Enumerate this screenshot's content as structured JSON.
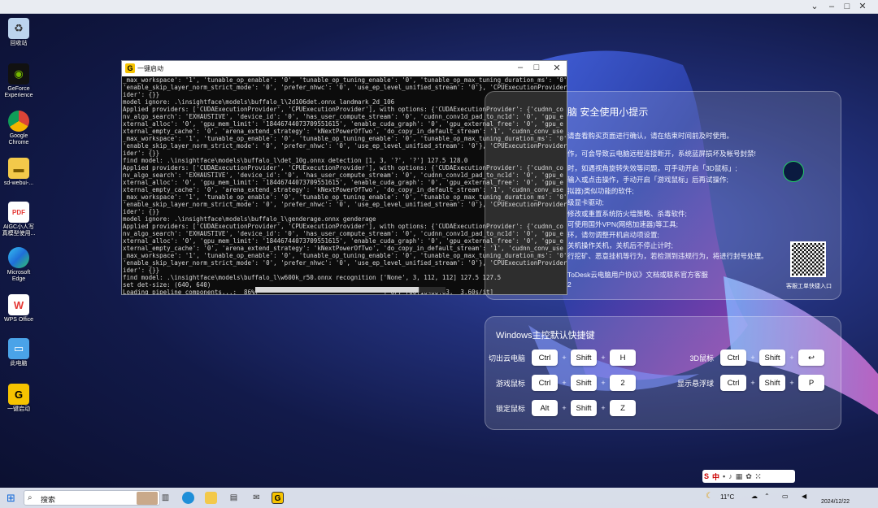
{
  "desktop": {
    "icons": [
      {
        "label": "回收站",
        "icon": "recycle-bin-icon",
        "color": "#bcd4ee"
      },
      {
        "label": "GeForce Experience",
        "icon": "geforce-icon",
        "color": "#76b900"
      },
      {
        "label": "Google Chrome",
        "icon": "chrome-icon",
        "color": "#db4437"
      },
      {
        "label": "sd-webui-...",
        "icon": "folder-icon",
        "color": "#f3c94a"
      },
      {
        "label": "AIGC小人写真模型使用...",
        "icon": "pdf-icon",
        "color": "#e53935"
      },
      {
        "label": "Microsoft Edge",
        "icon": "edge-icon",
        "color": "#1f8fd8"
      },
      {
        "label": "WPS Office",
        "icon": "wps-icon",
        "color": "#e53935"
      },
      {
        "label": "此电脑",
        "icon": "computer-icon",
        "color": "#4aa3e8"
      },
      {
        "label": "一键启动",
        "icon": "launcher-icon",
        "color": "#f6c300"
      }
    ]
  },
  "console": {
    "title": "一键启动",
    "lines": [
      "_max_workspace': '1', 'tunable_op_enable': '0', 'tunable_op_tuning_enable': '0', 'tunable_op_max_tuning_duration_ms': '0',",
      "'enable_skip_layer_norm_strict_mode': '0', 'prefer_nhwc': '0', 'use_ep_level_unified_stream': '0'}, 'CPUExecutionProvider':",
      "ider': {}}",
      "model ignore: .\\insightface\\models\\buffalo_l\\2d106det.onnx landmark_2d_106",
      "Applied providers: ['CUDAExecutionProvider', 'CPUExecutionProvider'], with options: {'CUDAExecutionProvider': {'cudnn_co",
      "nv_algo_search': 'EXHAUSTIVE', 'device_id': '0', 'has_user_compute_stream': '0', 'cudnn_conv1d_pad_to_nc1d': '0', 'gpu_e",
      "xternal_alloc': '0', 'gpu_mem_limit': '18446744073709551615', 'enable_cuda_graph': '0', 'gpu_external_free': '0', 'gpu_e",
      "xternal_empty_cache': '0', 'arena_extend_strategy': 'kNextPowerOfTwo', 'do_copy_in_default_stream': '1', 'cudnn_conv_use",
      "_max_workspace': '1', 'tunable_op_enable': '0', 'tunable_op_tuning_enable': '0', 'tunable_op_max_tuning_duration_ms': '0',",
      "'enable_skip_layer_norm_strict_mode': '0', 'prefer_nhwc': '0', 'use_ep_level_unified_stream': '0'}, 'CPUExecutionProvider':",
      "ider': {}}",
      "find model: .\\insightface\\models\\buffalo_l\\det_10g.onnx detection [1, 3, '?', '?'] 127.5 128.0",
      "Applied providers: ['CUDAExecutionProvider', 'CPUExecutionProvider'], with options: {'CUDAExecutionProvider': {'cudnn_co",
      "nv_algo_search': 'EXHAUSTIVE', 'device_id': '0', 'has_user_compute_stream': '0', 'cudnn_conv1d_pad_to_nc1d': '0', 'gpu_e",
      "xternal_alloc': '0', 'gpu_mem_limit': '18446744073709551615', 'enable_cuda_graph': '0', 'gpu_external_free': '0', 'gpu_e",
      "xternal_empty_cache': '0', 'arena_extend_strategy': 'kNextPowerOfTwo', 'do_copy_in_default_stream': '1', 'cudnn_conv_use",
      "_max_workspace': '1', 'tunable_op_enable': '0', 'tunable_op_tuning_enable': '0', 'tunable_op_max_tuning_duration_ms': '0',",
      "'enable_skip_layer_norm_strict_mode': '0', 'prefer_nhwc': '0', 'use_ep_level_unified_stream': '0'}, 'CPUExecutionProvider':",
      "ider': {}}",
      "model ignore: .\\insightface\\models\\buffalo_l\\genderage.onnx genderage",
      "Applied providers: ['CUDAExecutionProvider', 'CPUExecutionProvider'], with options: {'CUDAExecutionProvider': {'cudnn_co",
      "nv_algo_search': 'EXHAUSTIVE', 'device_id': '0', 'has_user_compute_stream': '0', 'cudnn_conv1d_pad_to_nc1d': '0', 'gpu_e",
      "xternal_alloc': '0', 'gpu_mem_limit': '18446744073709551615', 'enable_cuda_graph': '0', 'gpu_external_free': '0', 'gpu_e",
      "xternal_empty_cache': '0', 'arena_extend_strategy': 'kNextPowerOfTwo', 'do_copy_in_default_stream': '1', 'cudnn_conv_use",
      "_max_workspace': '1', 'tunable_op_enable': '0', 'tunable_op_tuning_enable': '0', 'tunable_op_max_tuning_duration_ms': '0',",
      "'enable_skip_layer_norm_strict_mode': '0', 'prefer_nhwc': '0', 'use_ep_level_unified_stream': '0'}, 'CPUExecutionProvider':",
      "ider': {}}",
      "find model: .\\insightface\\models\\buffalo_l\\w600k_r50.onnx recognition ['None', 3, 112, 112] 127.5 127.5",
      "set det-size: (640, 640)",
      "Loading pipeline components...:  86%|                                  | 6/7 [00:16<00:03,  3.60s/it]"
    ],
    "progress": 0.86
  },
  "tips_panel": {
    "title": "脑  安全使用小提示",
    "lines": [
      "请查看购买页面进行确认，请在结束时间前及时使用。",
      "作，可会导致云电脑远程连接断开，系统蓝屏损坏及帐号封禁!",
      "时，如遇视角旋转失效等问题，可手动开启「3D鼠标」;",
      "输入或点击操作，手动开启「游戏鼠标」后再试操作;",
      "拟器)类似功能的软件;",
      "级显卡驱动;",
      "修改或重置系统防火墙策略、杀毒软件;",
      "可使用国外VPN(网络加速器)等工具;",
      "环，请勿调整开机启动项设置;",
      "关机操作关机，关机后不停止计时;",
      "行挖矿、恶意挂机等行为，若检测到违规行为，将进行封号处理。",
      "ToDesk云电脑用户协议》文档或联系官方客服",
      "2"
    ],
    "qr_label": "客服工单快捷入口"
  },
  "shortcuts": {
    "title": "Windows主控默认快捷键",
    "items": [
      {
        "name": "切出云电脑",
        "keys": [
          "Ctrl",
          "Shift",
          "H"
        ]
      },
      {
        "name": "3D鼠标",
        "keys": [
          "Ctrl",
          "Shift",
          "↩"
        ]
      },
      {
        "name": "游戏鼠标",
        "keys": [
          "Ctrl",
          "Shift",
          "2"
        ]
      },
      {
        "name": "显示悬浮球",
        "keys": [
          "Ctrl",
          "Shift",
          "P"
        ]
      },
      {
        "name": "锁定鼠标",
        "keys": [
          "Alt",
          "Shift",
          "Z"
        ]
      }
    ],
    "plus": "+"
  },
  "ime": {
    "label": "中"
  },
  "taskbar": {
    "search_placeholder": "搜索",
    "weather": "11°C",
    "date": "2024/12/22"
  }
}
